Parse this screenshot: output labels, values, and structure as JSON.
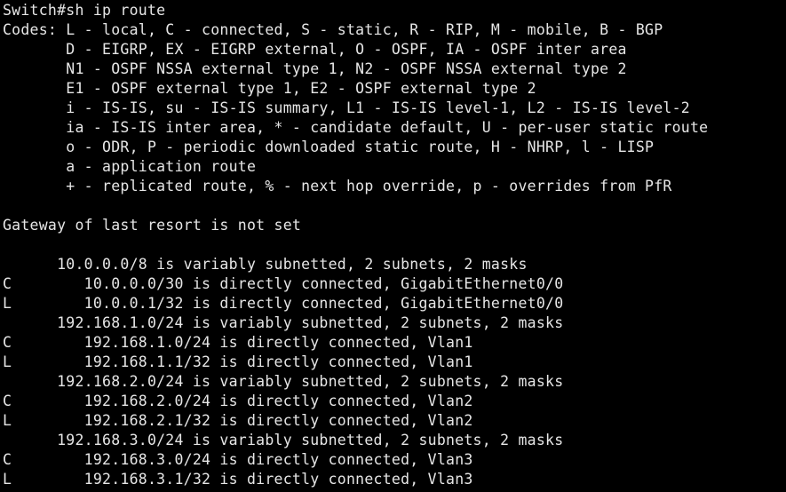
{
  "terminal": {
    "foreground": "#e6e6e6",
    "background": "#000000",
    "lines": [
      "Switch#sh ip route",
      "Codes: L - local, C - connected, S - static, R - RIP, M - mobile, B - BGP",
      "       D - EIGRP, EX - EIGRP external, O - OSPF, IA - OSPF inter area",
      "       N1 - OSPF NSSA external type 1, N2 - OSPF NSSA external type 2",
      "       E1 - OSPF external type 1, E2 - OSPF external type 2",
      "       i - IS-IS, su - IS-IS summary, L1 - IS-IS level-1, L2 - IS-IS level-2",
      "       ia - IS-IS inter area, * - candidate default, U - per-user static route",
      "       o - ODR, P - periodic downloaded static route, H - NHRP, l - LISP",
      "       a - application route",
      "       + - replicated route, % - next hop override, p - overrides from PfR",
      "",
      "Gateway of last resort is not set",
      "",
      "      10.0.0.0/8 is variably subnetted, 2 subnets, 2 masks",
      "C        10.0.0.0/30 is directly connected, GigabitEthernet0/0",
      "L        10.0.0.1/32 is directly connected, GigabitEthernet0/0",
      "      192.168.1.0/24 is variably subnetted, 2 subnets, 2 masks",
      "C        192.168.1.0/24 is directly connected, Vlan1",
      "L        192.168.1.1/32 is directly connected, Vlan1",
      "      192.168.2.0/24 is variably subnetted, 2 subnets, 2 masks",
      "C        192.168.2.0/24 is directly connected, Vlan2",
      "L        192.168.2.1/32 is directly connected, Vlan2",
      "      192.168.3.0/24 is variably subnetted, 2 subnets, 2 masks",
      "C        192.168.3.0/24 is directly connected, Vlan3",
      "L        192.168.3.1/32 is directly connected, Vlan3"
    ]
  }
}
